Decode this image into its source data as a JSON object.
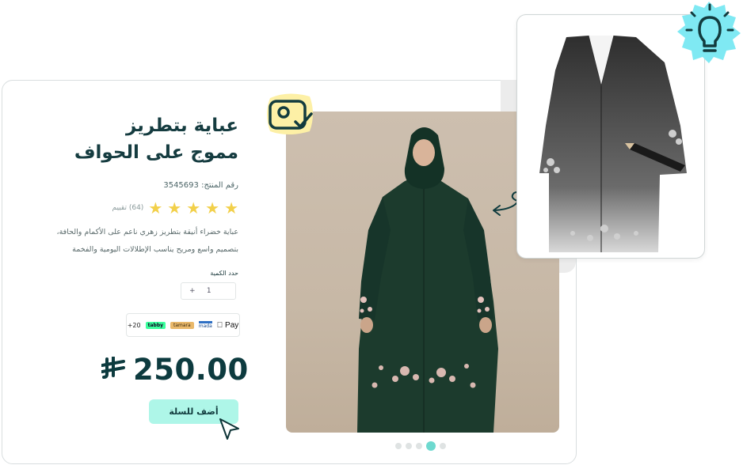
{
  "product": {
    "title_line1": "عباية بتطريز",
    "title_line2": "مموج على الحواف",
    "sku_label": "رقم المنتج:",
    "sku": "3545693",
    "rating_count": "(64) تقييم",
    "stars": 5,
    "description_line1": "عباية خضراء أنيقة بتطريز زهري ناعم على الأكمام والحافة،",
    "description_line2": "بتصميم واسع ومريح يناسب الإطلالات اليومية والفخمة"
  },
  "quantity": {
    "label": "حدد الكمية",
    "value": "1",
    "plus": "+"
  },
  "payments": {
    "apple": "Pay",
    "mada": "mada",
    "tamara": "tamara",
    "tabby": "tabby",
    "more": "+20"
  },
  "price": {
    "amount": "250.00",
    "currency": "⃁"
  },
  "cart": {
    "label": "أضف للسلة"
  },
  "carousel": {
    "count": 5,
    "active": 3
  },
  "colors": {
    "accent": "#aef6e8",
    "dress": "#1d3a2c",
    "badge_yellow": "#fdf0a6",
    "bulb_bg": "#7fe9f3"
  }
}
